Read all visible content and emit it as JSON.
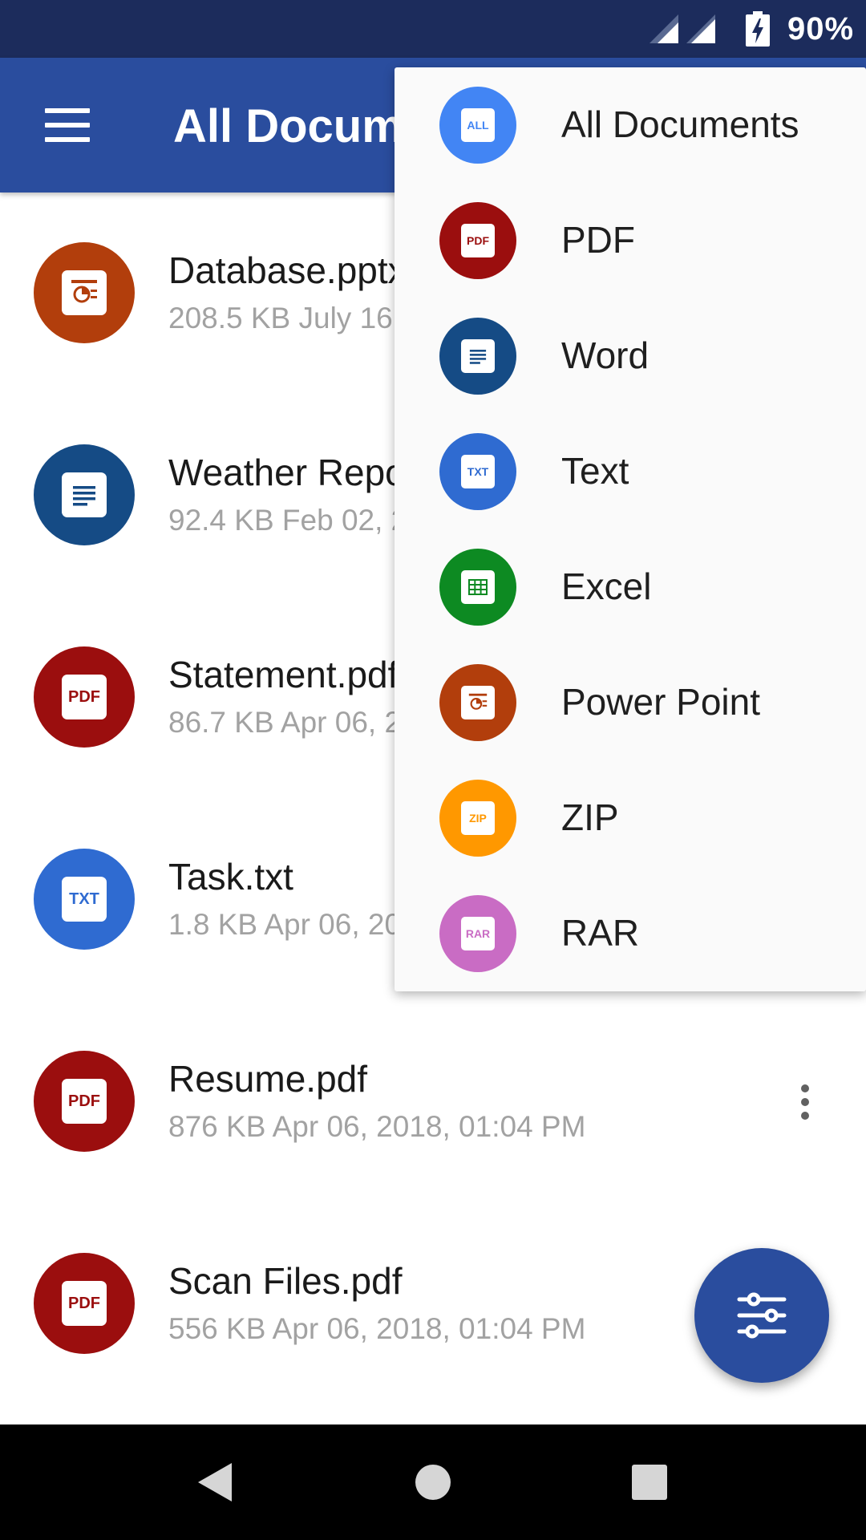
{
  "status_bar": {
    "battery_percent": "90%",
    "icons": [
      "cell-signal-icon",
      "wifi-signal-icon",
      "battery-charging-icon"
    ]
  },
  "app_bar": {
    "title": "All Documents",
    "menu_icon": "hamburger-menu-icon"
  },
  "files": [
    {
      "name": "Database.pptx",
      "meta": "208.5 KB July 16",
      "type": "Power Point",
      "badge": "",
      "color": "#b23e0c",
      "badge_color": "#b23e0c"
    },
    {
      "name": "Weather Report",
      "meta": "92.4 KB Feb 02, 2",
      "type": "Word",
      "badge": "",
      "color": "#154b85",
      "badge_color": "#154b85"
    },
    {
      "name": "Statement.pdf",
      "meta": "86.7 KB Apr 06, 2",
      "type": "PDF",
      "badge": "PDF",
      "color": "#9b0e0e",
      "badge_color": "#9b0e0e"
    },
    {
      "name": "Task.txt",
      "meta": "1.8 KB Apr 06, 20",
      "type": "Text",
      "badge": "TXT",
      "color": "#2f6bd1",
      "badge_color": "#2f6bd1"
    },
    {
      "name": "Resume.pdf",
      "meta": "876 KB Apr 06, 2018, 01:04 PM",
      "type": "PDF",
      "badge": "PDF",
      "color": "#9b0e0e",
      "badge_color": "#9b0e0e"
    },
    {
      "name": "Scan Files.pdf",
      "meta": "556 KB Apr 06, 2018, 01:04 PM",
      "type": "PDF",
      "badge": "PDF",
      "color": "#9b0e0e",
      "badge_color": "#9b0e0e"
    }
  ],
  "filter_menu": [
    {
      "label": "All Documents",
      "badge": "ALL",
      "color": "#4285f4",
      "badge_color": "#4285f4"
    },
    {
      "label": "PDF",
      "badge": "PDF",
      "color": "#9b0e0e",
      "badge_color": "#9b0e0e"
    },
    {
      "label": "Word",
      "badge": "",
      "color": "#154b85",
      "badge_color": "#154b85"
    },
    {
      "label": "Text",
      "badge": "TXT",
      "color": "#2f6bd1",
      "badge_color": "#2f6bd1"
    },
    {
      "label": "Excel",
      "badge": "",
      "color": "#0d8a22",
      "badge_color": "#0d8a22"
    },
    {
      "label": "Power Point",
      "badge": "",
      "color": "#b23e0c",
      "badge_color": "#b23e0c"
    },
    {
      "label": "ZIP",
      "badge": "ZIP",
      "color": "#ff9800",
      "badge_color": "#ff9800"
    },
    {
      "label": "RAR",
      "badge": "RAR",
      "color": "#c96cc4",
      "badge_color": "#c96cc4"
    }
  ],
  "fab": {
    "icon": "filter-sliders-icon"
  },
  "nav_bar": {
    "icons": [
      "back-icon",
      "home-icon",
      "recents-icon"
    ]
  },
  "colors": {
    "primary": "#2a4d9e",
    "status_bar": "#1c2c5c"
  }
}
